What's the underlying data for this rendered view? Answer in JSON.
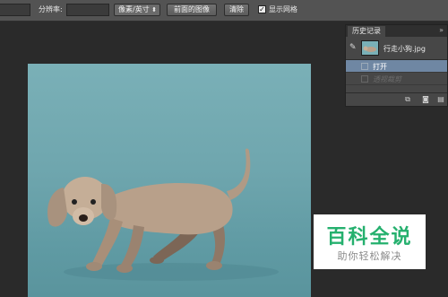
{
  "options_bar": {
    "width_value": "",
    "resolution_label": "分辨率:",
    "resolution_value": "",
    "units_select": "像素/英寸",
    "front_image_button": "前面的图像",
    "clear_button": "清除",
    "show_grid_checked": true,
    "show_grid_label": "显示网格"
  },
  "history_panel": {
    "tab_label": "历史记录",
    "menu_glyph": "»",
    "snapshot_name": "行走小狗.jpg",
    "items": [
      {
        "label": "打开",
        "selected": true
      },
      {
        "label": "透视裁剪",
        "selected": false
      }
    ],
    "footer_icons": [
      "new-document-from-state-icon",
      "camera-icon",
      "trash-icon"
    ]
  },
  "watermark": {
    "title": "百科全说",
    "subtitle": "助你轻松解决"
  },
  "colors": {
    "canvas_bg": "#6fa6ae",
    "selected_row": "#6f87a3",
    "watermark_green": "#25b06e"
  }
}
